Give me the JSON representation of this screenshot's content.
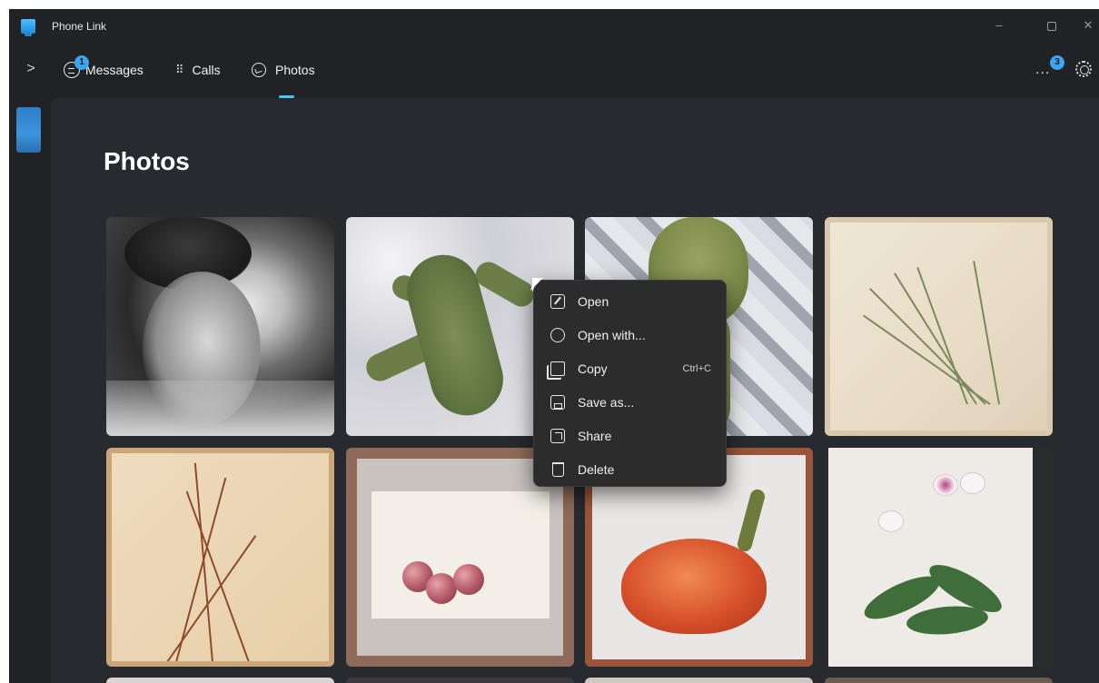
{
  "window": {
    "title": "Phone Link",
    "icon": "phone-link-app-icon",
    "controls": {
      "minimize": "–",
      "close": "✕"
    }
  },
  "nav": {
    "expand_icon": ">",
    "tabs": [
      {
        "label": "Messages",
        "icon": "messages-icon",
        "badge": "1"
      },
      {
        "label": "Calls",
        "icon": "calls-dialpad-icon"
      },
      {
        "label": "Photos",
        "icon": "photos-icon",
        "selected": true
      }
    ],
    "more_label": "...",
    "more_badge": "3",
    "settings_icon": "gear-icon"
  },
  "colors": {
    "accent": "#4cc2ff",
    "window_bg": "#202226",
    "panel_bg": "#272a2f",
    "menu_bg": "#2c2c2c"
  },
  "page": {
    "title": "Photos",
    "photos": [
      {
        "subject": "black-and-white portrait of singer"
      },
      {
        "subject": "green plush lizard toy"
      },
      {
        "subject": "green frog puppet"
      },
      {
        "subject": "botanical drawing of grass plant"
      },
      {
        "subject": "pussy willow branches painting"
      },
      {
        "subject": "cherries watercolor"
      },
      {
        "subject": "orange bell pepper painting"
      },
      {
        "subject": "orchid botanical drawing"
      },
      {
        "subject": "partially visible photo"
      },
      {
        "subject": "partially visible photo"
      },
      {
        "subject": "partially visible photo"
      },
      {
        "subject": "partially visible photo"
      }
    ]
  },
  "context_menu": {
    "items": [
      {
        "label": "Open",
        "icon": "open-edit-icon"
      },
      {
        "label": "Open with...",
        "icon": "open-with-icon"
      },
      {
        "label": "Copy",
        "icon": "copy-icon",
        "accelerator": "Ctrl+C"
      },
      {
        "label": "Save as...",
        "icon": "save-icon"
      },
      {
        "label": "Share",
        "icon": "share-icon"
      },
      {
        "label": "Delete",
        "icon": "delete-icon"
      }
    ]
  }
}
